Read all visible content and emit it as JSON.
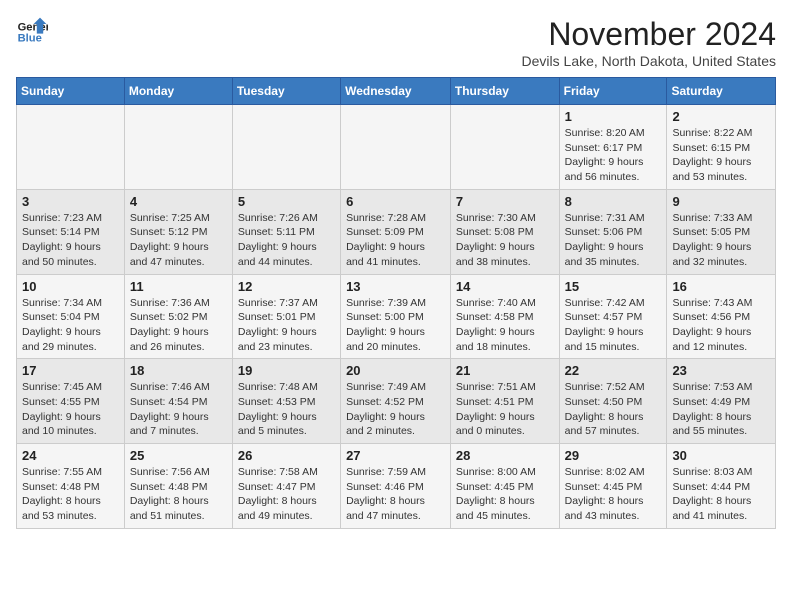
{
  "logo": {
    "line1": "General",
    "line2": "Blue"
  },
  "title": "November 2024",
  "subtitle": "Devils Lake, North Dakota, United States",
  "days_header": [
    "Sunday",
    "Monday",
    "Tuesday",
    "Wednesday",
    "Thursday",
    "Friday",
    "Saturday"
  ],
  "weeks": [
    [
      {
        "day": "",
        "info": ""
      },
      {
        "day": "",
        "info": ""
      },
      {
        "day": "",
        "info": ""
      },
      {
        "day": "",
        "info": ""
      },
      {
        "day": "",
        "info": ""
      },
      {
        "day": "1",
        "info": "Sunrise: 8:20 AM\nSunset: 6:17 PM\nDaylight: 9 hours and 56 minutes."
      },
      {
        "day": "2",
        "info": "Sunrise: 8:22 AM\nSunset: 6:15 PM\nDaylight: 9 hours and 53 minutes."
      }
    ],
    [
      {
        "day": "3",
        "info": "Sunrise: 7:23 AM\nSunset: 5:14 PM\nDaylight: 9 hours and 50 minutes."
      },
      {
        "day": "4",
        "info": "Sunrise: 7:25 AM\nSunset: 5:12 PM\nDaylight: 9 hours and 47 minutes."
      },
      {
        "day": "5",
        "info": "Sunrise: 7:26 AM\nSunset: 5:11 PM\nDaylight: 9 hours and 44 minutes."
      },
      {
        "day": "6",
        "info": "Sunrise: 7:28 AM\nSunset: 5:09 PM\nDaylight: 9 hours and 41 minutes."
      },
      {
        "day": "7",
        "info": "Sunrise: 7:30 AM\nSunset: 5:08 PM\nDaylight: 9 hours and 38 minutes."
      },
      {
        "day": "8",
        "info": "Sunrise: 7:31 AM\nSunset: 5:06 PM\nDaylight: 9 hours and 35 minutes."
      },
      {
        "day": "9",
        "info": "Sunrise: 7:33 AM\nSunset: 5:05 PM\nDaylight: 9 hours and 32 minutes."
      }
    ],
    [
      {
        "day": "10",
        "info": "Sunrise: 7:34 AM\nSunset: 5:04 PM\nDaylight: 9 hours and 29 minutes."
      },
      {
        "day": "11",
        "info": "Sunrise: 7:36 AM\nSunset: 5:02 PM\nDaylight: 9 hours and 26 minutes."
      },
      {
        "day": "12",
        "info": "Sunrise: 7:37 AM\nSunset: 5:01 PM\nDaylight: 9 hours and 23 minutes."
      },
      {
        "day": "13",
        "info": "Sunrise: 7:39 AM\nSunset: 5:00 PM\nDaylight: 9 hours and 20 minutes."
      },
      {
        "day": "14",
        "info": "Sunrise: 7:40 AM\nSunset: 4:58 PM\nDaylight: 9 hours and 18 minutes."
      },
      {
        "day": "15",
        "info": "Sunrise: 7:42 AM\nSunset: 4:57 PM\nDaylight: 9 hours and 15 minutes."
      },
      {
        "day": "16",
        "info": "Sunrise: 7:43 AM\nSunset: 4:56 PM\nDaylight: 9 hours and 12 minutes."
      }
    ],
    [
      {
        "day": "17",
        "info": "Sunrise: 7:45 AM\nSunset: 4:55 PM\nDaylight: 9 hours and 10 minutes."
      },
      {
        "day": "18",
        "info": "Sunrise: 7:46 AM\nSunset: 4:54 PM\nDaylight: 9 hours and 7 minutes."
      },
      {
        "day": "19",
        "info": "Sunrise: 7:48 AM\nSunset: 4:53 PM\nDaylight: 9 hours and 5 minutes."
      },
      {
        "day": "20",
        "info": "Sunrise: 7:49 AM\nSunset: 4:52 PM\nDaylight: 9 hours and 2 minutes."
      },
      {
        "day": "21",
        "info": "Sunrise: 7:51 AM\nSunset: 4:51 PM\nDaylight: 9 hours and 0 minutes."
      },
      {
        "day": "22",
        "info": "Sunrise: 7:52 AM\nSunset: 4:50 PM\nDaylight: 8 hours and 57 minutes."
      },
      {
        "day": "23",
        "info": "Sunrise: 7:53 AM\nSunset: 4:49 PM\nDaylight: 8 hours and 55 minutes."
      }
    ],
    [
      {
        "day": "24",
        "info": "Sunrise: 7:55 AM\nSunset: 4:48 PM\nDaylight: 8 hours and 53 minutes."
      },
      {
        "day": "25",
        "info": "Sunrise: 7:56 AM\nSunset: 4:48 PM\nDaylight: 8 hours and 51 minutes."
      },
      {
        "day": "26",
        "info": "Sunrise: 7:58 AM\nSunset: 4:47 PM\nDaylight: 8 hours and 49 minutes."
      },
      {
        "day": "27",
        "info": "Sunrise: 7:59 AM\nSunset: 4:46 PM\nDaylight: 8 hours and 47 minutes."
      },
      {
        "day": "28",
        "info": "Sunrise: 8:00 AM\nSunset: 4:45 PM\nDaylight: 8 hours and 45 minutes."
      },
      {
        "day": "29",
        "info": "Sunrise: 8:02 AM\nSunset: 4:45 PM\nDaylight: 8 hours and 43 minutes."
      },
      {
        "day": "30",
        "info": "Sunrise: 8:03 AM\nSunset: 4:44 PM\nDaylight: 8 hours and 41 minutes."
      }
    ]
  ]
}
